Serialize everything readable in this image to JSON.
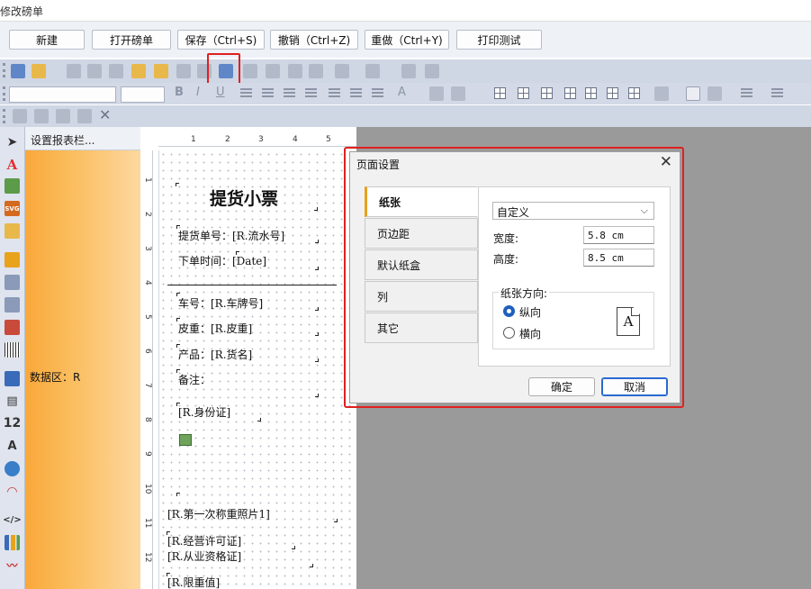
{
  "window": {
    "title": "修改磅单"
  },
  "actions": {
    "new": "新建",
    "open": "打开磅单",
    "save": "保存（Ctrl+S)",
    "undo": "撤销（Ctrl+Z)",
    "redo": "重做（Ctrl+Y)",
    "print_test": "打印测试"
  },
  "sidebar": {
    "band_header": "设置报表栏...",
    "band_label": "数据区：R"
  },
  "ruler": {
    "h": [
      "1",
      "2",
      "3",
      "4",
      "5"
    ],
    "v": [
      "1",
      "2",
      "3",
      "4",
      "5",
      "6",
      "7",
      "8",
      "9",
      "10",
      "11",
      "12"
    ]
  },
  "report": {
    "title": "提货小票",
    "fields": [
      "提货单号：[R.流水号]",
      "下单时间：[Date]",
      "车号：[R.车牌号]",
      "皮重：[R.皮重]",
      "产品：[R.货名]",
      "备注：",
      "[R.身份证]",
      "[R.第一次称重照片1]",
      "[R.经营许可证]",
      "[R.从业资格证]",
      "[R.限重值]"
    ]
  },
  "dialog": {
    "title": "页面设置",
    "tabs": [
      "纸张",
      "页边距",
      "默认纸盒",
      "列",
      "其它"
    ],
    "paper_size": "自定义",
    "width_label": "宽度:",
    "width_value": "5.8 cm",
    "height_label": "高度:",
    "height_value": "8.5 cm",
    "orientation_title": "纸张方向:",
    "portrait": "纵向",
    "landscape": "横向",
    "orientation_selected": "纵向",
    "page_icon_letter": "A",
    "ok": "确定",
    "cancel": "取消"
  },
  "colors": {
    "highlight": "#e02020",
    "tab_accent": "#e8a21c",
    "radio_on": "#1f5fbf",
    "band": "#f9a83a"
  }
}
